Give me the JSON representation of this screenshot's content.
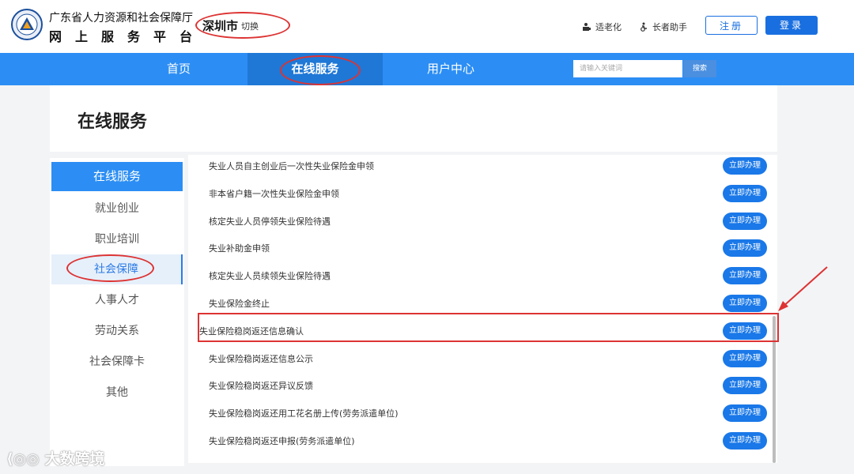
{
  "header": {
    "org_name": "广东省人力资源和社会保障厅",
    "platform_name": "网上服务平台",
    "city": "深圳市",
    "city_switch": "切换",
    "elder_mode": "适老化",
    "elder_helper": "长者助手",
    "register": "注册",
    "login": "登录"
  },
  "nav": {
    "items": [
      "首页",
      "在线服务",
      "用户中心"
    ],
    "active": "在线服务",
    "search_placeholder": "请输入关键词",
    "search_button": "搜索",
    "bar_color": "#2c8ef4"
  },
  "page": {
    "title": "在线服务"
  },
  "sidebar": {
    "header": "在线服务",
    "items": [
      "就业创业",
      "职业培训",
      "社会保障",
      "人事人才",
      "劳动关系",
      "社会保障卡",
      "其他"
    ],
    "active": "社会保障"
  },
  "services": {
    "items": [
      "失业人员自主创业后一次性失业保险金申领",
      "非本省户籍一次性失业保险金申领",
      "核定失业人员停领失业保险待遇",
      "失业补助金申领",
      "核定失业人员续领失业保险待遇",
      "失业保险金终止",
      "失业保险稳岗返还信息确认",
      "失业保险稳岗返还信息公示",
      "失业保险稳岗返还异议反馈",
      "失业保险稳岗返还用工花名册上传(劳务派遣单位)",
      "失业保险稳岗返还申报(劳务派遣单位)"
    ],
    "action_label": "立即办理",
    "highlighted": "失业保险稳岗返还信息确认",
    "button_color": "#1a78e8"
  },
  "annotation_color": "#dd3333",
  "watermark": "大数跨境"
}
